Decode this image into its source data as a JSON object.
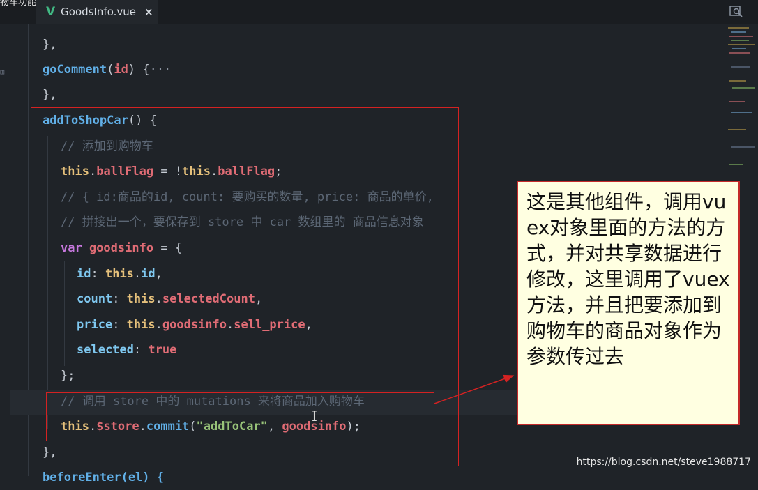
{
  "window": {
    "label": "物车功能"
  },
  "tab": {
    "icon": "vue-icon",
    "filename": "GoodsInfo.vue",
    "close": "×"
  },
  "code": {
    "l0": "},",
    "l1_fn": "goComment",
    "l1_p1": "(",
    "l1_arg": "id",
    "l1_p2": ") {",
    "l1_ell": "···",
    "l2": "},",
    "l3_fn": "addToShopCar",
    "l3_p": "() {",
    "l4_cm": "// 添加到购物车",
    "l5_this": "this",
    "l5_a": ".",
    "l5_prop": "ballFlag",
    "l5_b": " = !",
    "l5_this2": "this",
    "l5_c": ".",
    "l5_prop2": "ballFlag",
    "l5_d": ";",
    "l6_cm": "// { id:商品的id, count: 要购买的数量, price: 商品的单价, ",
    "l7_cm": "// 拼接出一个，要保存到 store 中 car 数组里的 商品信息对象",
    "l8_kw": "var",
    "l8_var": " goodsinfo",
    "l8_p": " = {",
    "l9_key": "id",
    "l9_a": ": ",
    "l9_this": "this",
    "l9_b": ".",
    "l9_prop": "id",
    "l9_c": ",",
    "l10_key": "count",
    "l10_a": ": ",
    "l10_this": "this",
    "l10_b": ".",
    "l10_prop": "selectedCount",
    "l10_c": ",",
    "l11_key": "price",
    "l11_a": ": ",
    "l11_this": "this",
    "l11_b": ".",
    "l11_prop": "goodsinfo",
    "l11_c": ".",
    "l11_prop2": "sell_price",
    "l11_d": ",",
    "l12_key": "selected",
    "l12_a": ": ",
    "l12_val": "true",
    "l13": "};",
    "l14_cm": "// 调用 store 中的 mutations 来将商品加入购物车",
    "l15_this": "this",
    "l15_a": ".",
    "l15_store": "$store",
    "l15_b": ".",
    "l15_fn": "commit",
    "l15_c": "(",
    "l15_str": "\"addToCar\"",
    "l15_d": ", ",
    "l15_arg": "goodsinfo",
    "l15_e": ");",
    "l16": "},",
    "l17": "beforeEnter(el) {"
  },
  "callout": {
    "text": "这是其他组件，调用vuex对象里面的方法的方式，并对共享数据进行修改，这里调用了vuex方法，并且把要添加到购物车的商品对象作为参数传过去"
  },
  "watermark": "https://blog.csdn.net/steve1988717",
  "colors": {
    "annotation_red": "#d42222",
    "callout_bg": "#ffffe1"
  }
}
